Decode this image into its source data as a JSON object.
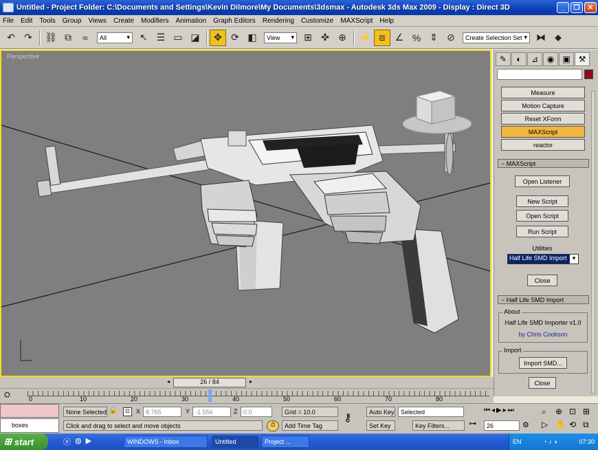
{
  "window": {
    "title": "Untitled - Project Folder: C:\\Documents and Settings\\Kevin Dilmore\\My Documents\\3dsmax - Autodesk 3ds Max 2009 - Display : Direct 3D"
  },
  "menu": [
    "File",
    "Edit",
    "Tools",
    "Group",
    "Views",
    "Create",
    "Modifiers",
    "Animation",
    "Graph Editors",
    "Rendering",
    "Customize",
    "MAXScript",
    "Help"
  ],
  "toolbar": {
    "filter_value": "All",
    "coord_value": "View",
    "selection_set_placeholder": "Create Selection Set"
  },
  "viewport": {
    "label": "Perspective"
  },
  "command_panel": {
    "utility_buttons": [
      "Measure",
      "Motion Capture",
      "Reset XForm",
      "MAXScript",
      "reactor"
    ],
    "maxscript_rollout": "MAXScript",
    "maxscript_buttons": [
      "Open Listener",
      "New Script",
      "Open Script",
      "Run Script"
    ],
    "utilities_label": "Utilities",
    "utilities_value": "Half Life SMD Import",
    "close_label": "Close",
    "smd_rollout": "Half Life SMD Import",
    "about_label": "About",
    "about_title": "Half Life SMD Importer v1.0",
    "about_author": "by Chris Cookson",
    "import_label": "Import",
    "import_button": "Import SMD...",
    "close2_label": "Close"
  },
  "time": {
    "slider_value": "26 / 84",
    "ticks": [
      "0",
      "10",
      "20",
      "30",
      "40",
      "50",
      "60",
      "70",
      "80"
    ]
  },
  "status": {
    "listener_text": "boxes",
    "selection": "None Selected",
    "x_label": "X",
    "x_value": "8.765",
    "y_label": "Y",
    "y_value": "-1.556",
    "z_label": "Z",
    "z_value": "0.0",
    "grid": "Grid = 10.0",
    "prompt": "Click and drag to select and move objects",
    "add_time_tag": "Add Time Tag",
    "auto_key": "Auto Key",
    "set_key": "Set Key",
    "selected": "Selected",
    "key_filters": "Key Filters...",
    "frame": "26"
  },
  "taskbar": {
    "start": "start",
    "items": [
      "WINDOWS - Inbox",
      "Untitled",
      "Project ..."
    ],
    "clock": "07:30",
    "lang": "EN"
  }
}
